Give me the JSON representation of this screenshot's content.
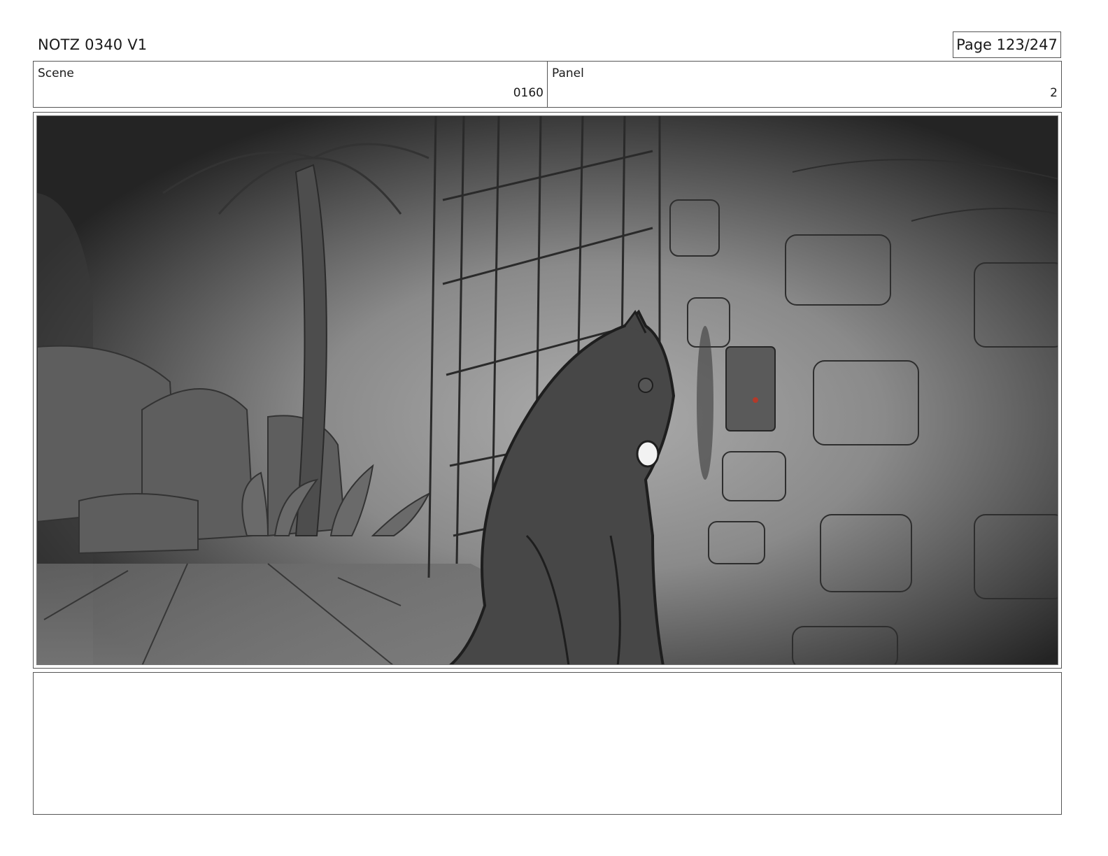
{
  "header": {
    "title": "NOTZ 0340 V1",
    "page": "Page 123/247"
  },
  "info": {
    "scene_label": "Scene",
    "scene_value": "0160",
    "panel_label": "Panel",
    "panel_value": "2"
  },
  "panel": {
    "image_subject": "storyboard sketch: dark cat sitting beside barred gate and stone wall, palm tree and rocks in background",
    "palette": {
      "light": "#a8a8a8",
      "mid": "#6e6e6e",
      "dark": "#262626",
      "figure": "#474747",
      "line": "#1e1e1e",
      "accent_red": "#b33a2a"
    }
  },
  "notes": {
    "text": ""
  }
}
